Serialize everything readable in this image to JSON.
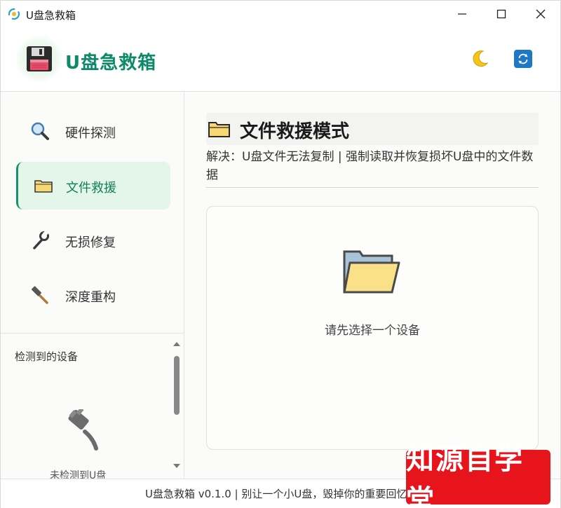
{
  "window": {
    "title": "U盘急救箱",
    "minimize_label": "minimize",
    "maximize_label": "maximize",
    "close_label": "close"
  },
  "header": {
    "app_name": "U盘急救箱",
    "icons": [
      "floppy-disk-icon",
      "moon-icon",
      "refresh-icon"
    ]
  },
  "sidebar": {
    "items": [
      {
        "label": "硬件探测",
        "icon": "magnifier-icon",
        "active": false
      },
      {
        "label": "文件救援",
        "icon": "folder-icon",
        "active": true
      },
      {
        "label": "无损修复",
        "icon": "wrench-icon",
        "active": false
      },
      {
        "label": "深度重构",
        "icon": "hammer-icon",
        "active": false
      }
    ],
    "devices": {
      "title": "检测到的设备",
      "empty_text": "未检测到U盘",
      "icon": "plug-icon"
    }
  },
  "main": {
    "title": "文件救援模式",
    "description": "解决：U盘文件无法复制 | 强制读取并恢复损坏U盘中的文件数据",
    "panel": {
      "hint": "请先选择一个设备",
      "icon": "open-folder-icon"
    }
  },
  "footer": {
    "text": "U盘急救箱 v0.1.0   |   别让一个小U盘，毁掉你的重要回忆"
  },
  "watermark": {
    "text": "知源自学堂"
  },
  "colors": {
    "accent": "#0f8a68",
    "active_bg": "#e4f6ea",
    "refresh_bg": "#1d79c8",
    "watermark_bg": "#e8141c"
  }
}
